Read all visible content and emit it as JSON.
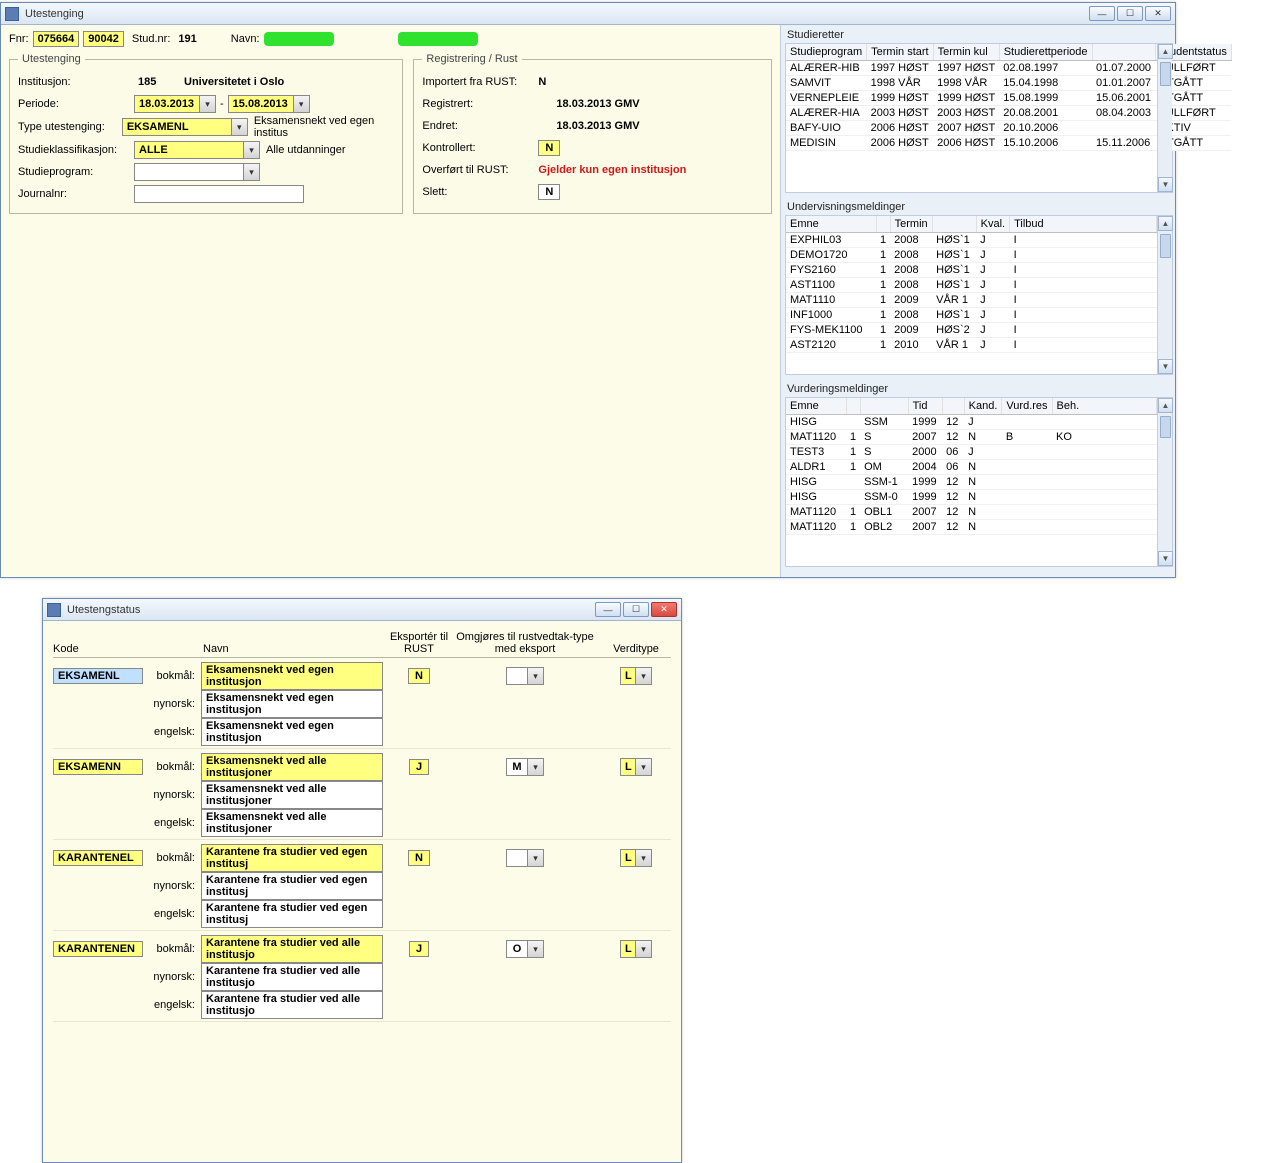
{
  "win1": {
    "title": "Utestenging",
    "header": {
      "fnr_label": "Fnr:",
      "fnr1": "075664",
      "fnr2": "90042",
      "studnr_label": "Stud.nr:",
      "studnr": "191",
      "navn_label": "Navn:"
    },
    "utestenging": {
      "legend": "Utestenging",
      "institusjon_label": "Institusjon:",
      "institusjon_kode": "185",
      "institusjon_navn": "Universitetet i Oslo",
      "periode_label": "Periode:",
      "periode_fra": "18.03.2013",
      "periode_sep": "-",
      "periode_til": "15.08.2013",
      "type_label": "Type utestenging:",
      "type_kode": "EKSAMENL",
      "type_desc": "Eksamensnekt ved egen institus",
      "klass_label": "Studieklassifikasjon:",
      "klass_kode": "ALLE",
      "klass_desc": "Alle utdanninger",
      "studieprogram_label": "Studieprogram:",
      "journalnr_label": "Journalnr:"
    },
    "rust": {
      "legend": "Registrering / Rust",
      "importert_label": "Importert fra RUST:",
      "importert": "N",
      "registrert_label": "Registrert:",
      "registrert": "18.03.2013  GMV",
      "endret_label": "Endret:",
      "endret": "18.03.2013  GMV",
      "kontrollert_label": "Kontrollert:",
      "kontrollert": "N",
      "overfort_label": "Overført til RUST:",
      "overfort": "Gjelder kun egen institusjon",
      "slett_label": "Slett:",
      "slett": "N"
    }
  },
  "studieretter": {
    "title": "Studieretter",
    "headers": [
      "Studieprogram",
      "Termin start",
      "Termin kul",
      "Studierettperiode",
      "",
      "Studentstatus"
    ],
    "rows": [
      [
        "ALÆRER-HIB",
        "1997 HØST",
        "1997 HØST",
        "02.08.1997",
        "01.07.2000",
        "FULLFØRT"
      ],
      [
        "SAMVIT",
        "1998 VÅR",
        "1998 VÅR",
        "15.04.1998",
        "01.01.2007",
        "UTGÅTT"
      ],
      [
        "VERNEPLEIE",
        "1999 HØST",
        "1999 HØST",
        "15.08.1999",
        "15.06.2001",
        "UTGÅTT"
      ],
      [
        "ALÆRER-HIA",
        "2003 HØST",
        "2003 HØST",
        "20.08.2001",
        "08.04.2003",
        "FULLFØRT"
      ],
      [
        "BAFY-UIO",
        "2006 HØST",
        "2007 HØST",
        "20.10.2006",
        "",
        "AKTIV"
      ],
      [
        "MEDISIN",
        "2006 HØST",
        "2006 HØST",
        "15.10.2006",
        "15.11.2006",
        "UTGÅTT"
      ]
    ]
  },
  "undervisning": {
    "title": "Undervisningsmeldinger",
    "headers": [
      "Emne",
      "",
      "Termin",
      "",
      "Kval.",
      "Tilbud"
    ],
    "rows": [
      [
        "EXPHIL03",
        "1",
        "2008",
        "HØS`1",
        "J",
        "I"
      ],
      [
        "DEMO1720",
        "1",
        "2008",
        "HØS`1",
        "J",
        "I"
      ],
      [
        "FYS2160",
        "1",
        "2008",
        "HØS`1",
        "J",
        "I"
      ],
      [
        "AST1100",
        "1",
        "2008",
        "HØS`1",
        "J",
        "I"
      ],
      [
        "MAT1110",
        "1",
        "2009",
        "VÅR 1",
        "J",
        "I"
      ],
      [
        "INF1000",
        "1",
        "2008",
        "HØS`1",
        "J",
        "I"
      ],
      [
        "FYS-MEK1100",
        "1",
        "2009",
        "HØS`2",
        "J",
        "I"
      ],
      [
        "AST2120",
        "1",
        "2010",
        "VÅR 1",
        "J",
        "I"
      ]
    ]
  },
  "vurdering": {
    "title": "Vurderingsmeldinger",
    "headers": [
      "Emne",
      "",
      "",
      "Tid",
      "",
      "Kand.",
      "Vurd.res",
      "Beh."
    ],
    "rows": [
      [
        "HISG",
        "",
        "SSM",
        "1999",
        "12",
        "J",
        "",
        ""
      ],
      [
        "MAT1120",
        "1",
        "S",
        "2007",
        "12",
        "N",
        "B",
        "KO"
      ],
      [
        "TEST3",
        "1",
        "S",
        "2000",
        "06",
        "J",
        "",
        ""
      ],
      [
        "ALDR1",
        "1",
        "OM",
        "2004",
        "06",
        "N",
        "",
        ""
      ],
      [
        "HISG",
        "",
        "SSM-1",
        "1999",
        "12",
        "N",
        "",
        ""
      ],
      [
        "HISG",
        "",
        "SSM-0",
        "1999",
        "12",
        "N",
        "",
        ""
      ],
      [
        "MAT1120",
        "1",
        "OBL1",
        "2007",
        "12",
        "N",
        "",
        ""
      ],
      [
        "MAT1120",
        "1",
        "OBL2",
        "2007",
        "12",
        "N",
        "",
        ""
      ]
    ]
  },
  "win2": {
    "title": "Utestengstatus",
    "headers": {
      "kode": "Kode",
      "navn": "Navn",
      "eksporter": "Eksportér til RUST",
      "omgjores": "Omgjøres til rustvedtak-type med eksport",
      "verditype": "Verditype"
    },
    "lang": {
      "bokmal": "bokmål:",
      "nynorsk": "nynorsk:",
      "engelsk": "engelsk:"
    },
    "items": [
      {
        "kode": "EKSAMENL",
        "selected": true,
        "bokmal": "Eksamensnekt ved egen institusjon",
        "nynorsk": "Eksamensnekt ved egen institusjon",
        "engelsk": "Eksamensnekt ved egen institusjon",
        "eksport": "N",
        "omg": "",
        "verdi": "L"
      },
      {
        "kode": "EKSAMENN",
        "bokmal": "Eksamensnekt ved alle institusjoner",
        "nynorsk": "Eksamensnekt ved alle institusjoner",
        "engelsk": "Eksamensnekt ved alle institusjoner",
        "eksport": "J",
        "omg": "M",
        "verdi": "L"
      },
      {
        "kode": "KARANTENEL",
        "bokmal": "Karantene fra studier ved egen institusj",
        "nynorsk": "Karantene fra studier ved egen institusj",
        "engelsk": "Karantene fra studier ved egen institusj",
        "eksport": "N",
        "omg": "",
        "verdi": "L"
      },
      {
        "kode": "KARANTENEN",
        "bokmal": "Karantene fra studier ved alle institusjo",
        "nynorsk": "Karantene fra studier ved alle institusjo",
        "engelsk": "Karantene fra studier ved alle institusjo",
        "eksport": "J",
        "omg": "O",
        "verdi": "L"
      }
    ]
  }
}
